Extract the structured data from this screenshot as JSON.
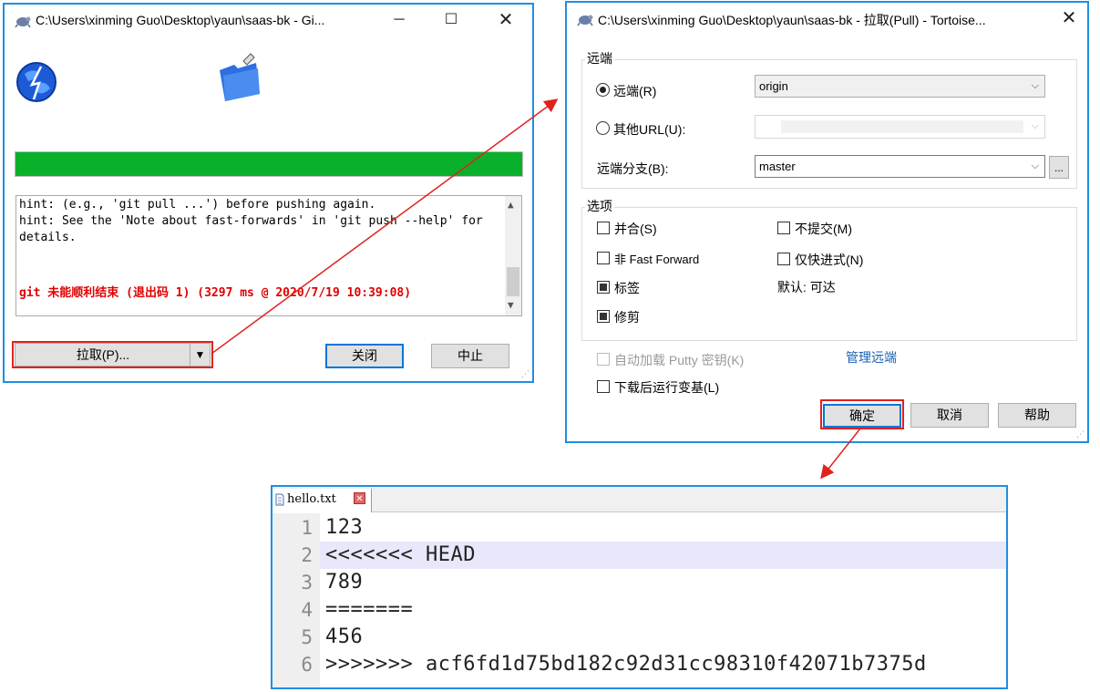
{
  "progress_window": {
    "title": "C:\\Users\\xinming Guo\\Desktop\\yaun\\saas-bk - Gi...",
    "progress_fraction": 1.0,
    "progress_color": "#09b12a",
    "log_lines": [
      "hint: (e.g., 'git pull ...') before pushing again.",
      "hint: See the 'Note about fast-forwards' in 'git push --help' for",
      "details."
    ],
    "error_line": "git 未能顺利结束 (退出码 1) (3297 ms @ 2020/7/19 10:39:08)",
    "pull_button": "拉取(P)...",
    "close_button": "关闭",
    "abort_button": "中止",
    "icons": [
      "globe-icon",
      "folder-icon"
    ]
  },
  "pull_dialog": {
    "title": "C:\\Users\\xinming Guo\\Desktop\\yaun\\saas-bk - 拉取(Pull) - Tortoise...",
    "remote_group": "远端",
    "remote_radio": "远端(R)",
    "remote_value": "origin",
    "other_url_radio": "其他URL(U):",
    "remote_branch_label": "远端分支(B):",
    "remote_branch_value": "master",
    "browse_button": "...",
    "options_group": "选项",
    "opt_merge": "并合(S)",
    "opt_no_commit": "不提交(M)",
    "opt_no_ff": "非 Fast Forward",
    "opt_ff_only": "仅快进式(N)",
    "opt_tags": "标签",
    "opt_tags_default": "默认: 可达",
    "opt_prune": "修剪",
    "autoload_putty": "自动加载 Putty 密钥(K)",
    "manage_remotes": "管理远端",
    "rebase_after": "下载后运行变基(L)",
    "ok_button": "确定",
    "cancel_button": "取消",
    "help_button": "帮助"
  },
  "editor": {
    "tab_name": "hello.txt",
    "lines": [
      {
        "num": "1",
        "text": "123"
      },
      {
        "num": "2",
        "text": "<<<<<<< HEAD"
      },
      {
        "num": "3",
        "text": "789"
      },
      {
        "num": "4",
        "text": "======="
      },
      {
        "num": "5",
        "text": "456"
      },
      {
        "num": "6",
        "text": ">>>>>>> acf6fd1d75bd182c92d31cc98310f42071b7375d"
      }
    ],
    "highlight_color": "#e8e8fa"
  },
  "colors": {
    "window_border": "#1e8fe0",
    "annotation_red": "#e0221e",
    "error_text": "#e00000"
  }
}
